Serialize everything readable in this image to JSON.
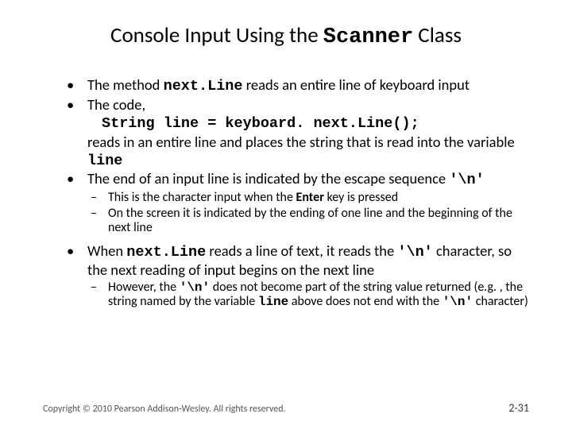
{
  "title_pre": "Console Input Using the ",
  "title_mono": "Scanner",
  "title_post": " Class",
  "b1_pre": "The method ",
  "b1_mono": "next.Line",
  "b1_post": " reads an entire line of keyboard input",
  "b2": "The code,",
  "code_line": "String line = keyboard. next.Line();",
  "cont_pre": "reads in an entire line and places the string that is read into the variable ",
  "cont_mono": "line",
  "b3_pre": "The end of an input line is indicated by the escape sequence ",
  "b3_mono": "'\\n'",
  "s1_pre": "This is the character input when the ",
  "s1_bold": "Enter",
  "s1_post": " key is pressed",
  "s2": "On the screen it is indicated by the ending of one line and the beginning of the next line",
  "b4_pre": "When ",
  "b4_m1": "next.Line",
  "b4_mid": " reads a line of text, it reads the ",
  "b4_m2": "'\\n'",
  "b4_post": " character, so the next reading of input begins on the next line",
  "s3_pre": "However, the ",
  "s3_m1": "'\\n'",
  "s3_mid1": " does not become part of the string value returned (e.g. , the string named by the variable ",
  "s3_m2": "line",
  "s3_mid2": " above does not end with the ",
  "s3_m3": "'\\n'",
  "s3_post": " character)",
  "copyright": "Copyright © 2010 Pearson Addison-Wesley. All rights reserved.",
  "page": "2-31"
}
